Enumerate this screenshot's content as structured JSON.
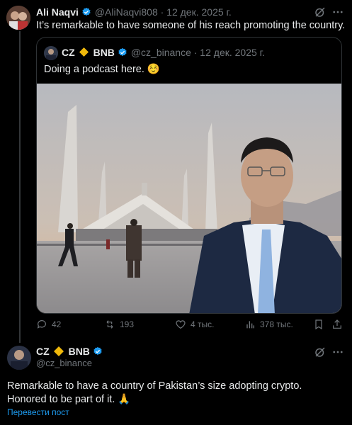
{
  "post": {
    "author_name": "Ali Naqvi",
    "handle_date": "@AliNaqvi808 · 12 дек. 2025 г.",
    "text": "It’s remarkable to have someone of his reach promoting the country."
  },
  "quote": {
    "author_name": "CZ",
    "brand": "BNB",
    "handle_date": "@cz_binance · 12 дек. 2025 г.",
    "text": "Doing a podcast here. ☺️"
  },
  "actions": {
    "replies": "42",
    "reposts": "193",
    "likes": "4 тыс.",
    "views": "378 тыс."
  },
  "reply": {
    "author_name": "CZ",
    "brand": "BNB",
    "handle": "@cz_binance",
    "text_line1": "Remarkable to have a country of Pakistan’s size adopting crypto.",
    "text_line2": "Honored to be part of it. 🙏",
    "translate_label": "Перевести пост"
  },
  "colors": {
    "background": "#000000",
    "verified": "#1d9bf0",
    "muted": "#71767b",
    "bnb": "#f0b90b"
  }
}
